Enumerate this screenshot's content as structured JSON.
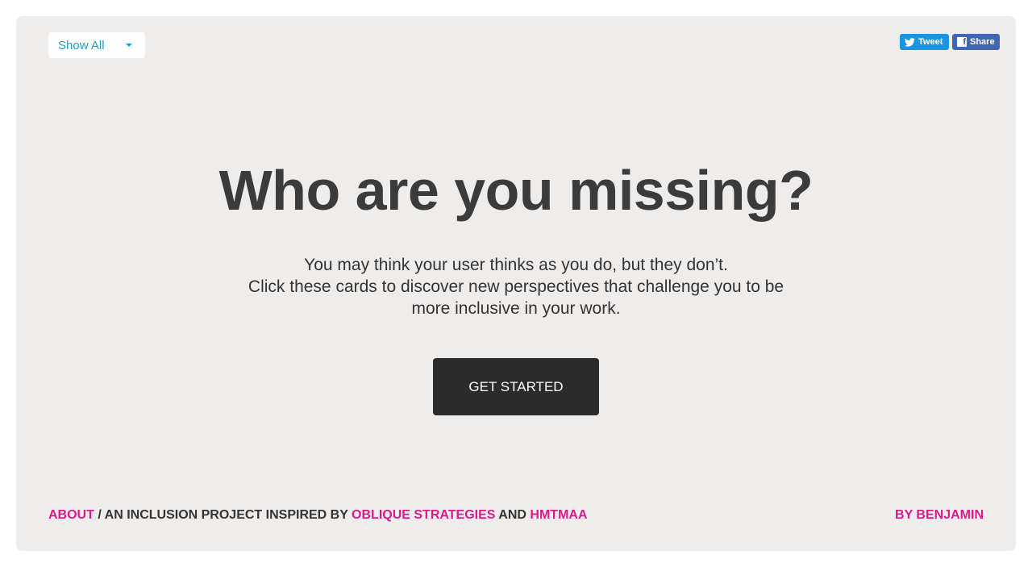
{
  "filter": {
    "selected": "Show All"
  },
  "social": {
    "tweet_label": "Tweet",
    "share_label": "Share"
  },
  "hero": {
    "title": "Who are you missing?",
    "intro_lines": [
      "You may think your user thinks as you do, but they don’t.",
      "Click these cards to discover new perspectives that challenge you to be",
      "more inclusive in your work."
    ],
    "cta_label": "GET STARTED"
  },
  "footer": {
    "about_label": "ABOUT",
    "sep_text": " / AN INCLUSION PROJECT INSPIRED BY ",
    "oblique_label": "OBLIQUE STRATEGIES",
    "and_text": " AND ",
    "hmtmaa_label": "HMTMAA",
    "credit_label": "BY BENJAMIN"
  },
  "colors": {
    "accent_link": "#d91a8c",
    "filter_text": "#1aa3c7",
    "card_bg": "#efedec",
    "cta_bg": "#2b2b2b",
    "tweet_bg": "#1b95e0",
    "share_bg": "#4267b2"
  },
  "icons": {
    "filter_caret": "chevron-down-icon",
    "tweet": "twitter-bird-icon",
    "share": "facebook-f-icon"
  }
}
